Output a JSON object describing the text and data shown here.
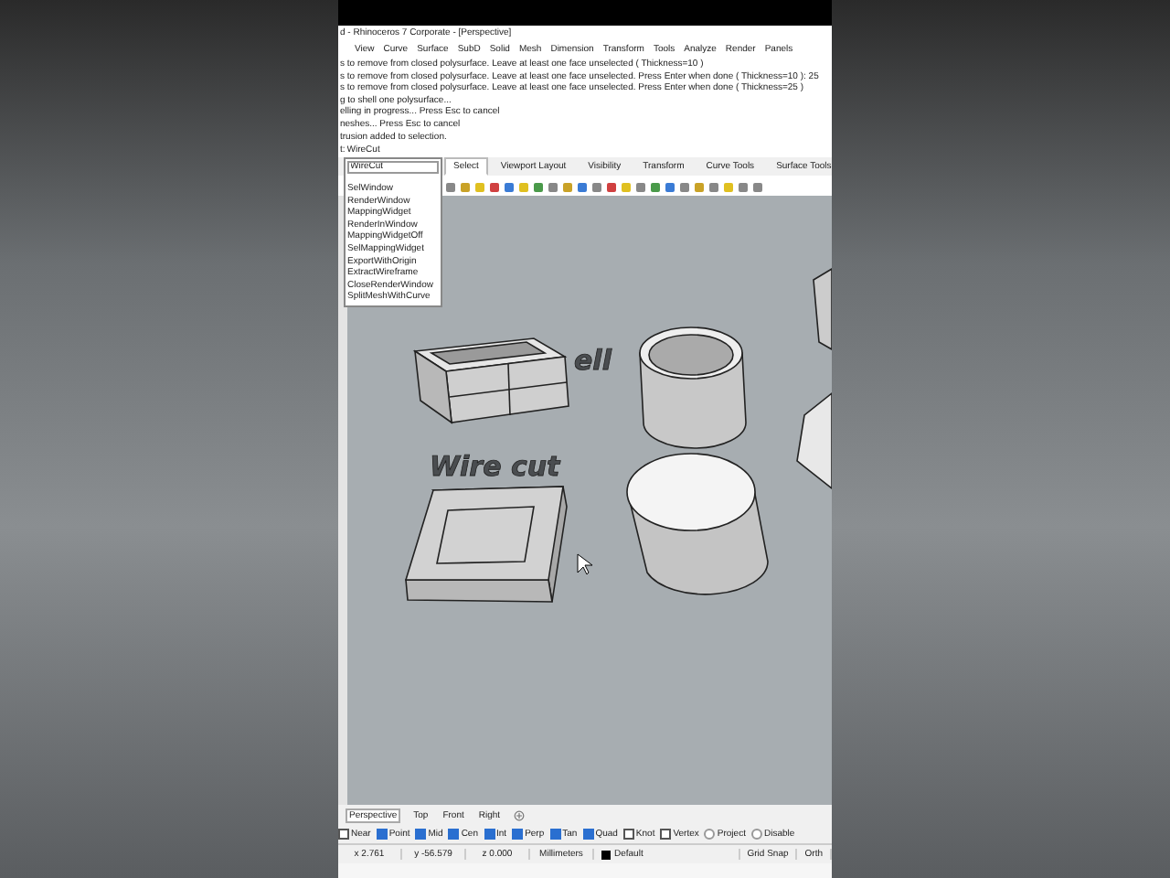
{
  "window": {
    "title": "d - Rhinoceros 7 Corporate - [Perspective]"
  },
  "menu": [
    "View",
    "Curve",
    "Surface",
    "SubD",
    "Solid",
    "Mesh",
    "Dimension",
    "Transform",
    "Tools",
    "Analyze",
    "Render",
    "Panels"
  ],
  "history": [
    "s to remove from closed polysurface. Leave at least one face unselected ( Thickness=10 )",
    "s to remove from closed polysurface. Leave at least one face unselected. Press Enter when done ( Thickness=10 ): 25",
    "s to remove from closed polysurface. Leave at least one face unselected. Press Enter when done ( Thickness=25 )",
    "g to shell one polysurface...",
    "elling in progress... Press Esc to cancel",
    "neshes... Press Esc to cancel",
    "trusion added to selection."
  ],
  "command": {
    "prompt": "t:",
    "value": "WireCut"
  },
  "autocomplete": {
    "value": "WireCut",
    "items": [
      "SelWindow",
      "RenderWindow",
      "MappingWidget",
      "RenderInWindow",
      "MappingWidgetOff",
      "SelMappingWidget",
      "ExportWithOrigin",
      "ExtractWireframe",
      "CloseRenderWindow",
      "SplitMeshWithCurve"
    ]
  },
  "toolbar_tabs": [
    {
      "label": "Select",
      "selected": true
    },
    {
      "label": "Viewport Layout",
      "selected": false
    },
    {
      "label": "Visibility",
      "selected": false
    },
    {
      "label": "Transform",
      "selected": false
    },
    {
      "label": "Curve Tools",
      "selected": false
    },
    {
      "label": "Surface Tools",
      "selected": false
    }
  ],
  "viewport": {
    "labels": [
      "ell",
      "Wire cut"
    ]
  },
  "viewport_tabs": [
    {
      "label": "Perspective",
      "selected": true
    },
    {
      "label": "Top",
      "selected": false
    },
    {
      "label": "Front",
      "selected": false
    },
    {
      "label": "Right",
      "selected": false
    }
  ],
  "osnaps": [
    {
      "kind": "checkbox",
      "label": "Near",
      "checked": false
    },
    {
      "kind": "checkbox",
      "label": "Point",
      "checked": true
    },
    {
      "kind": "checkbox",
      "label": "Mid",
      "checked": true
    },
    {
      "kind": "checkbox",
      "label": "Cen",
      "checked": true
    },
    {
      "kind": "checkbox",
      "label": "Int",
      "checked": true
    },
    {
      "kind": "checkbox",
      "label": "Perp",
      "checked": true
    },
    {
      "kind": "checkbox",
      "label": "Tan",
      "checked": true
    },
    {
      "kind": "checkbox",
      "label": "Quad",
      "checked": true
    },
    {
      "kind": "checkbox",
      "label": "Knot",
      "checked": false
    },
    {
      "kind": "checkbox",
      "label": "Vertex",
      "checked": false
    },
    {
      "kind": "radio",
      "label": "Project",
      "checked": false
    },
    {
      "kind": "radio",
      "label": "Disable",
      "checked": false
    }
  ],
  "status_bar": {
    "x": "x 2.761",
    "y": "y -56.579",
    "z": "z 0.000",
    "units": "Millimeters",
    "layer": "Default",
    "grid_snap": "Grid Snap",
    "ortho": "Orth"
  }
}
